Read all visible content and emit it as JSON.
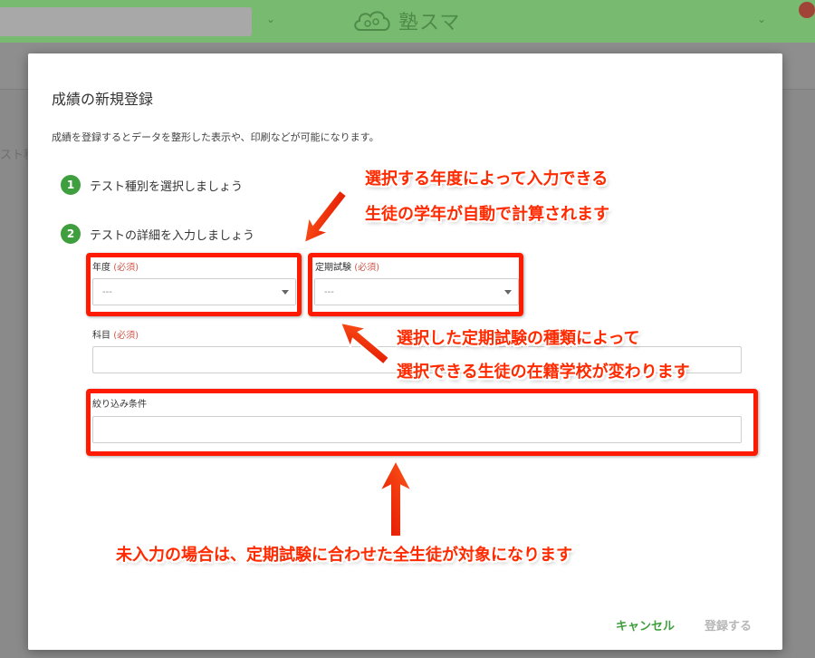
{
  "header": {
    "app_name": "塾スマ"
  },
  "background": {
    "fragment_text": "スト種"
  },
  "modal": {
    "title": "成績の新規登録",
    "description": "成績を登録するとデータを整形した表示や、印刷などが可能になります。",
    "steps": [
      {
        "number": "1",
        "label": "テスト種別を選択しましょう"
      },
      {
        "number": "2",
        "label": "テストの詳細を入力しましょう"
      }
    ],
    "fields": {
      "year": {
        "label": "年度",
        "required": "(必須)",
        "value": "---"
      },
      "exam": {
        "label": "定期試験",
        "required": "(必須)",
        "value": "---"
      },
      "subject": {
        "label": "科目",
        "required": "(必須)",
        "value": ""
      },
      "filter": {
        "label": "絞り込み条件",
        "value": ""
      }
    },
    "buttons": {
      "cancel": "キャンセル",
      "submit": "登録する"
    }
  },
  "annotations": {
    "callout_top_line1": "選択する年度によって入力できる",
    "callout_top_line2": "生徒の学年が自動で計算されます",
    "callout_mid_line1": "選択した定期試験の種類によって",
    "callout_mid_line2": "選択できる生徒の在籍学校が変わります",
    "callout_bottom": "未入力の場合は、定期試験に合わせた全生徒が対象になります"
  },
  "colors": {
    "brand_green": "#3f9e3d",
    "header_green": "#78bb70",
    "required_red": "#d0584a",
    "annotation_red": "#ff1a00"
  }
}
